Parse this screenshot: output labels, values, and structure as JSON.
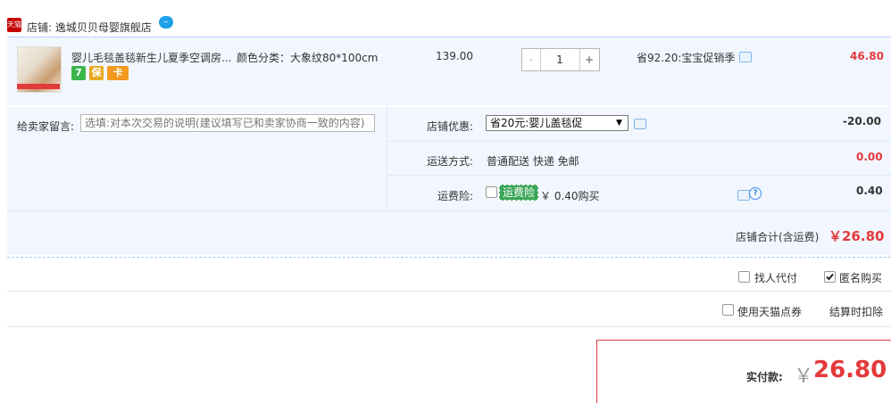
{
  "shop": {
    "label": "店铺: 逸城贝贝母婴旗舰店",
    "logo_text": "天猫",
    "wangwang_text": "~"
  },
  "item": {
    "title": "婴儿毛毯盖毯新生儿夏季空调房...",
    "spec": "颜色分类：大象纹80*100cm",
    "badges": [
      "7",
      "保",
      "卡"
    ],
    "price": "139.00",
    "quantity": "1",
    "qty_minus": "-",
    "qty_plus": "+",
    "promo": "省92.20:宝宝促销季",
    "total": "46.80"
  },
  "memo": {
    "label": "给卖家留言:",
    "placeholder": "选填:对本次交易的说明(建议填写已和卖家协商一致的内容)"
  },
  "shop_discount": {
    "label": "店铺优惠:",
    "selected": "省20元:婴儿盖毯促",
    "value": "-20.00"
  },
  "shipping": {
    "label": "运送方式:",
    "text": "普通配送 快递 免邮",
    "value": "0.00"
  },
  "insurance": {
    "label": "运费险:",
    "tag": "运费险",
    "text": "￥ 0.40购买",
    "value": "0.40"
  },
  "shop_total": {
    "label": "店铺合计(含运费)",
    "value": "￥26.80"
  },
  "options": {
    "proxy_pay": "找人代付",
    "anonymous": "匿名购买",
    "tmall_points": "使用天猫点券",
    "deduct_note": "结算时扣除"
  },
  "payment": {
    "label": "实付款:",
    "currency": "￥",
    "amount": "26.80"
  },
  "colors": {
    "accent_red": "#e4393c",
    "panel_bg": "#f2f7ff",
    "tag_green": "#3aa657"
  },
  "icons": [
    "tmall-logo-icon",
    "wangwang-icon",
    "message-icon",
    "question-icon",
    "dropdown-arrow-icon",
    "checkbox-icon"
  ]
}
